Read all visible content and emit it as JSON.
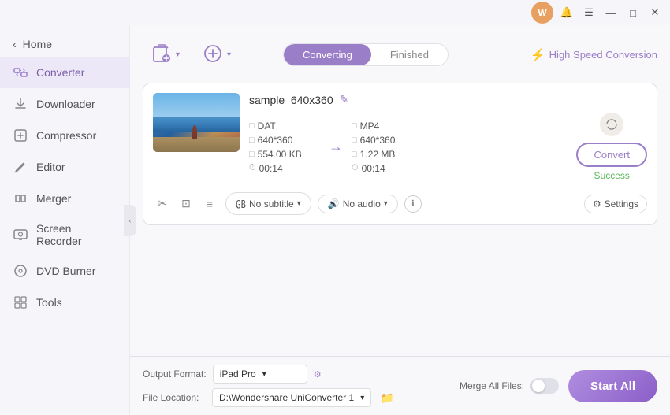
{
  "titlebar": {
    "user_initial": "W",
    "bell_icon": "bell",
    "menu_icon": "menu",
    "minimize_icon": "—",
    "maximize_icon": "□",
    "close_icon": "✕"
  },
  "sidebar": {
    "home_label": "Home",
    "items": [
      {
        "id": "converter",
        "label": "Converter",
        "icon": "⇄",
        "active": true
      },
      {
        "id": "downloader",
        "label": "Downloader",
        "icon": "↓"
      },
      {
        "id": "compressor",
        "label": "Compressor",
        "icon": "⊡"
      },
      {
        "id": "editor",
        "label": "Editor",
        "icon": "✎"
      },
      {
        "id": "merger",
        "label": "Merger",
        "icon": "⊞"
      },
      {
        "id": "screen-recorder",
        "label": "Screen Recorder",
        "icon": "▣"
      },
      {
        "id": "dvd-burner",
        "label": "DVD Burner",
        "icon": "⊙"
      },
      {
        "id": "tools",
        "label": "Tools",
        "icon": "⊞"
      }
    ]
  },
  "toolbar": {
    "add_files_label": "Add Files",
    "add_more_label": "Add More",
    "tab_converting": "Converting",
    "tab_finished": "Finished",
    "high_speed_label": "High Speed Conversion"
  },
  "file_card": {
    "filename": "sample_640x360",
    "source": {
      "format": "DAT",
      "resolution": "640*360",
      "size": "554.00 KB",
      "duration": "00:14"
    },
    "target": {
      "format": "MP4",
      "resolution": "640*360",
      "size": "1.22 MB",
      "duration": "00:14"
    },
    "convert_btn_label": "Convert",
    "status": "Success",
    "subtitle_label": "No subtitle",
    "audio_label": "No audio",
    "settings_label": "Settings"
  },
  "bottom_bar": {
    "output_format_label": "Output Format:",
    "output_format_value": "iPad Pro",
    "file_location_label": "File Location:",
    "file_location_value": "D:\\Wondershare UniConverter 1",
    "merge_files_label": "Merge All Files:",
    "start_all_label": "Start All"
  }
}
